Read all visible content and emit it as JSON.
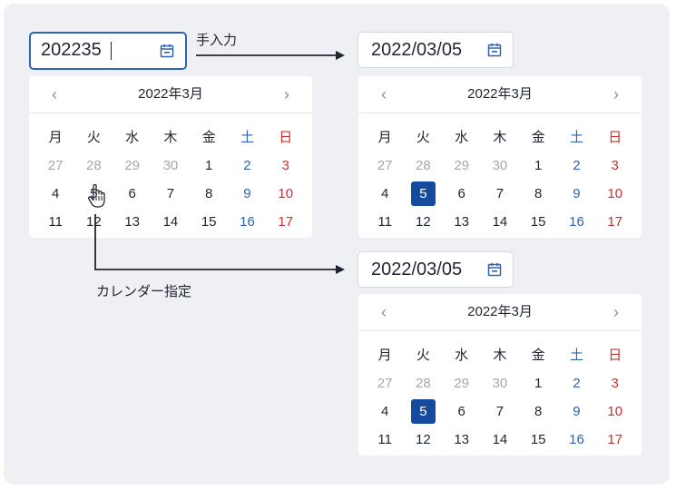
{
  "manual": {
    "value": "202235",
    "label": "手入力",
    "result_value": "2022/03/05"
  },
  "picker": {
    "label": "カレンダー指定",
    "result_value": "2022/03/05"
  },
  "calendar": {
    "month_title": "2022年3月",
    "prev": "‹",
    "next": "›",
    "weekdays": [
      "月",
      "火",
      "水",
      "木",
      "金",
      "土",
      "日"
    ],
    "weeks": [
      [
        "27",
        "28",
        "29",
        "30",
        "1",
        "2",
        "3"
      ],
      [
        "4",
        "5",
        "6",
        "7",
        "8",
        "9",
        "10"
      ],
      [
        "11",
        "12",
        "13",
        "14",
        "15",
        "16",
        "17"
      ]
    ],
    "muted_days": [
      "27",
      "28",
      "29",
      "30"
    ],
    "selected_day": "5"
  },
  "colors": {
    "background": "#eef0f3",
    "accent": "#154a9e",
    "focus_border": "#2f63b3",
    "saturday": "#2d63b2",
    "sunday": "#c8302f"
  },
  "icons": [
    "calendar-icon",
    "hand-pointer-icon"
  ]
}
